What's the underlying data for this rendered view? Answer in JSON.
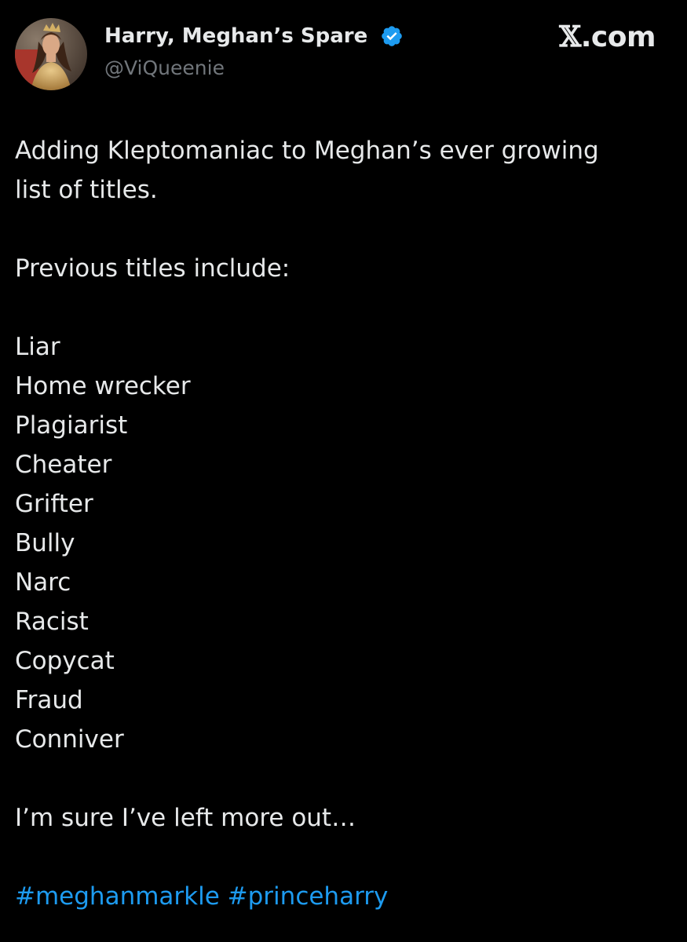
{
  "author": {
    "display_name": "Harry, Meghan’s Spare",
    "handle": "@ViQueenie",
    "verified": true,
    "avatar_icon": "profile-photo"
  },
  "source": {
    "x_mark": "𝕏",
    "domain": ".com"
  },
  "post": {
    "intro_line_1": "Adding Kleptomaniac to Meghan’s ever growing",
    "intro_line_2": "list of titles.",
    "list_heading": "Previous titles include:",
    "titles": [
      "Liar",
      "Home wrecker",
      "Plagiarist",
      "Cheater",
      "Grifter",
      "Bully",
      "Narc",
      "Racist",
      "Copycat",
      "Fraud",
      "Conniver"
    ],
    "closing": "I’m sure I’ve left more out…",
    "hashtags": [
      "#meghanmarkle",
      "#princeharry"
    ]
  },
  "colors": {
    "background": "#000000",
    "text": "#e7e9ea",
    "secondary_text": "#71767b",
    "link": "#1d9bf0",
    "verified_badge": "#1d9bf0"
  }
}
